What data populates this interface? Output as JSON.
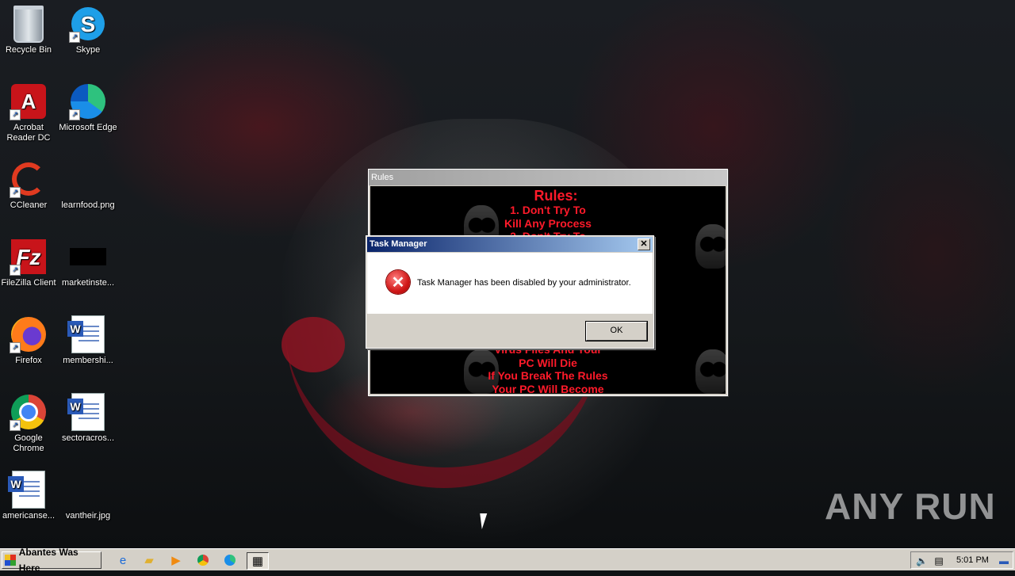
{
  "desktop": {
    "icons": [
      {
        "label": "Recycle Bin",
        "icon": "recycle-bin-icon"
      },
      {
        "label": "Skype",
        "icon": "skype-icon"
      },
      {
        "label": "Acrobat Reader DC",
        "icon": "acrobat-icon"
      },
      {
        "label": "Microsoft Edge",
        "icon": "edge-icon"
      },
      {
        "label": "CCleaner",
        "icon": "ccleaner-icon"
      },
      {
        "label": "learnfood.png",
        "icon": "image-file-icon"
      },
      {
        "label": "FileZilla Client",
        "icon": "filezilla-icon"
      },
      {
        "label": "marketinste...",
        "icon": "image-file-icon"
      },
      {
        "label": "Firefox",
        "icon": "firefox-icon"
      },
      {
        "label": "membershi...",
        "icon": "word-document-icon"
      },
      {
        "label": "Google Chrome",
        "icon": "chrome-icon"
      },
      {
        "label": "sectoracros...",
        "icon": "word-document-icon"
      },
      {
        "label": "americanse...",
        "icon": "word-document-icon"
      },
      {
        "label": "vantheir.jpg",
        "icon": "image-file-icon"
      }
    ]
  },
  "rules_window": {
    "title": "Rules",
    "heading": "Rules:",
    "lines_top": [
      "1. Don't Try To",
      "Kill Any Process",
      "2. Don't Try To"
    ],
    "lines_bottom": [
      "Virus Files And Your",
      "PC Will Die",
      "If You Break The Rules",
      "Your PC Will Become"
    ]
  },
  "task_manager_dialog": {
    "title": "Task Manager",
    "message": "Task Manager has been disabled by your administrator.",
    "ok_label": "OK",
    "close_glyph": "✕"
  },
  "watermark": "ANY RUN",
  "taskbar": {
    "start_label": "Abantes Was Here",
    "clock": "5:01 PM",
    "quick_launch": [
      "internet-explorer-icon",
      "folder-icon",
      "media-player-icon",
      "chrome-icon",
      "edge-icon",
      "task-manager-icon"
    ]
  }
}
